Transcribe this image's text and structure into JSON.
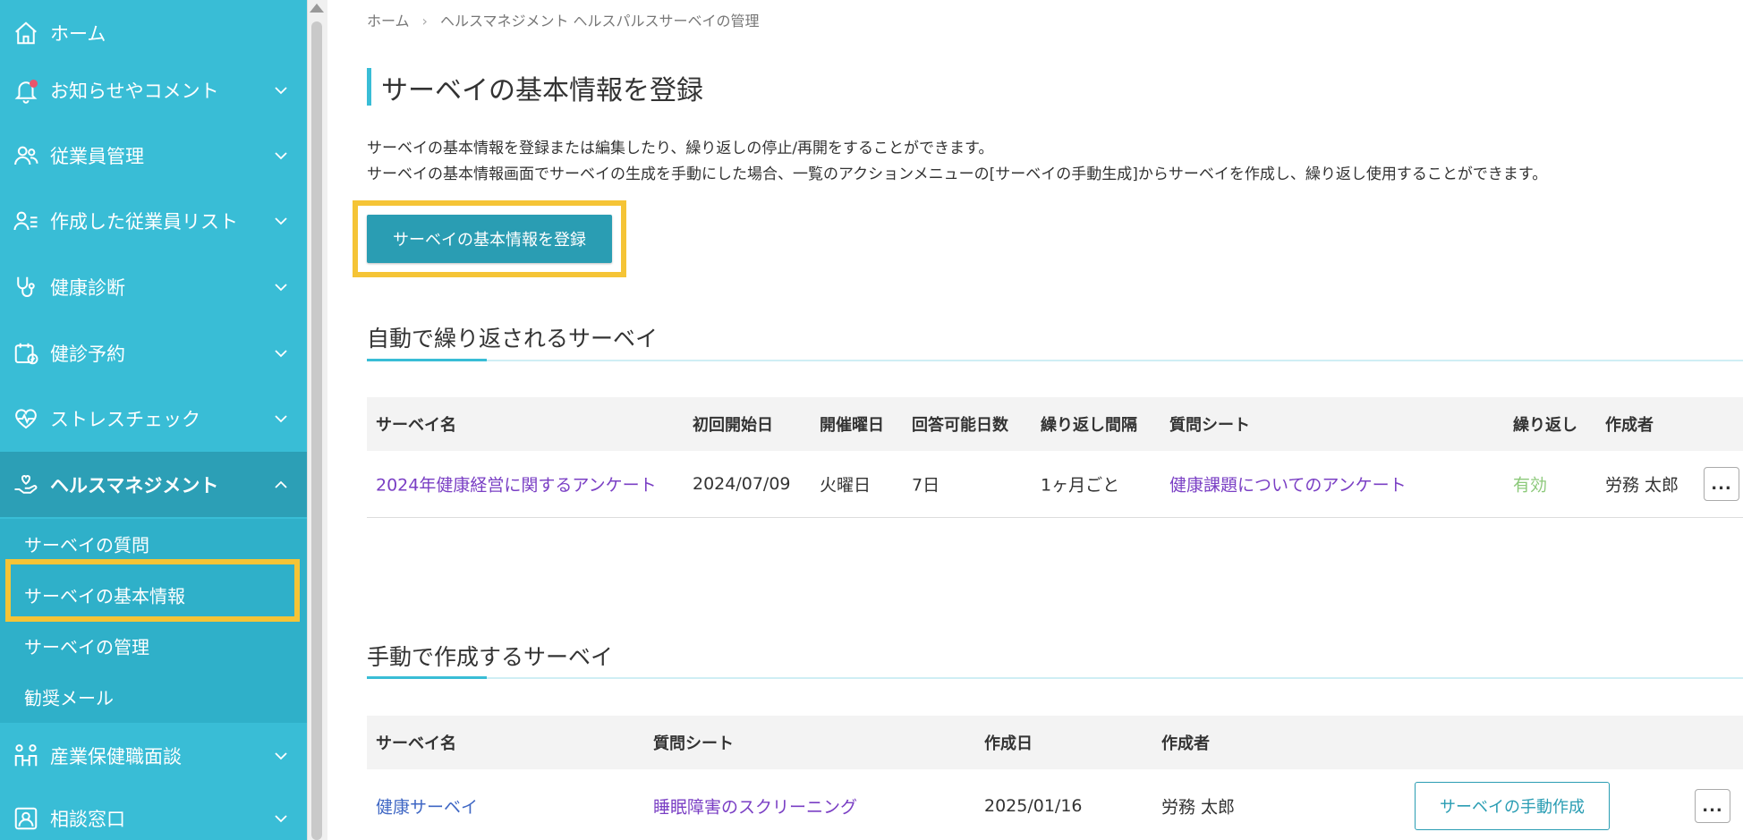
{
  "sidebar": {
    "items": [
      {
        "label": "ホーム",
        "icon": "home-icon"
      },
      {
        "label": "お知らせやコメント",
        "icon": "bell-icon"
      },
      {
        "label": "従業員管理",
        "icon": "users-icon"
      },
      {
        "label": "作成した従業員リスト",
        "icon": "user-list-icon"
      },
      {
        "label": "健康診断",
        "icon": "stethoscope-icon"
      },
      {
        "label": "健診予約",
        "icon": "calendar-check-icon"
      },
      {
        "label": "ストレスチェック",
        "icon": "heart-icon"
      },
      {
        "label": "ヘルスマネジメント",
        "icon": "health-hand-icon"
      },
      {
        "label": "産業保健職面談",
        "icon": "meeting-icon"
      },
      {
        "label": "相談窓口",
        "icon": "consult-icon"
      }
    ],
    "submenu": [
      {
        "label": "サーベイの質問"
      },
      {
        "label": "サーベイの基本情報"
      },
      {
        "label": "サーベイの管理"
      },
      {
        "label": "勧奨メール"
      }
    ]
  },
  "breadcrumb": {
    "home": "ホーム",
    "current": "ヘルスマネジメント ヘルスパルスサーベイの管理"
  },
  "page": {
    "title": "サーベイの基本情報を登録",
    "desc1": "サーベイの基本情報を登録または編集したり、繰り返しの停止/再開をすることができます。",
    "desc2": "サーベイの基本情報画面でサーベイの生成を手動にした場合、一覧のアクションメニューの[サーベイの手動生成]からサーベイを作成し、繰り返し使用することができます。",
    "register_button": "サーベイの基本情報を登録"
  },
  "auto_section": {
    "title": "自動で繰り返されるサーベイ",
    "headers": [
      "サーベイ名",
      "初回開始日",
      "開催曜日",
      "回答可能日数",
      "繰り返し間隔",
      "質問シート",
      "繰り返し",
      "作成者"
    ],
    "rows": [
      {
        "name": "2024年健康経営に関するアンケート",
        "start": "2024/07/09",
        "weekday": "火曜日",
        "days": "7日",
        "interval": "1ヶ月ごと",
        "sheet": "健康課題についてのアンケート",
        "repeat": "有効",
        "author": "労務 太郎",
        "more": "..."
      }
    ]
  },
  "manual_section": {
    "title": "手動で作成するサーベイ",
    "headers": [
      "サーベイ名",
      "質問シート",
      "作成日",
      "作成者"
    ],
    "rows": [
      {
        "name": "健康サーベイ",
        "sheet": "睡眠障害のスクリーニング",
        "created": "2025/01/16",
        "author": "労務 太郎",
        "action": "サーベイの手動作成",
        "more": "..."
      }
    ]
  },
  "colors": {
    "sidebar": "#39bdd6",
    "sidebar_active": "#2c9fb6",
    "accent": "#2a9db3",
    "highlight": "#f5c436",
    "link": "#7a3fc4",
    "enabled": "#8cc97a"
  }
}
